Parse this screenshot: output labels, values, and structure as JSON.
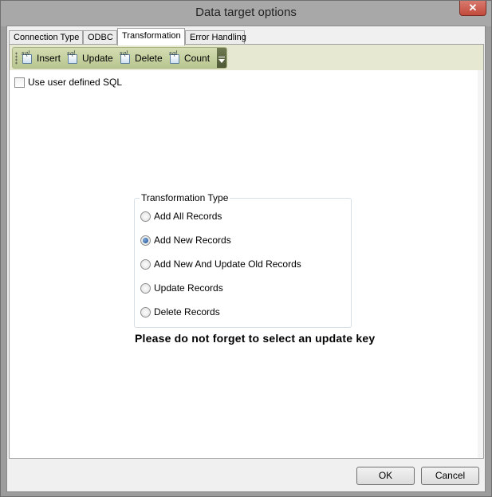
{
  "window": {
    "title": "Data target options",
    "close_glyph": "✕"
  },
  "tabs": [
    {
      "label": "Connection Type",
      "active": false
    },
    {
      "label": "ODBC",
      "active": false
    },
    {
      "label": "Transformation",
      "active": true
    },
    {
      "label": "Error Handling",
      "active": false
    }
  ],
  "toolbar": {
    "buttons": [
      {
        "label": "Insert",
        "icon": "sql-icon",
        "icon_text": "sql"
      },
      {
        "label": "Update",
        "icon": "sql-icon",
        "icon_text": "sql"
      },
      {
        "label": "Delete",
        "icon": "sql-icon",
        "icon_text": "sql"
      },
      {
        "label": "Count",
        "icon": "sql-icon",
        "icon_text": "sql"
      }
    ],
    "overflow_icon": "chevron-down-icon"
  },
  "options": {
    "use_user_defined_sql_label": "Use user defined SQL",
    "use_user_defined_sql_checked": false
  },
  "transformation_type": {
    "legend": "Transformation Type",
    "choices": [
      {
        "label": "Add All Records",
        "checked": false
      },
      {
        "label": "Add New Records",
        "checked": true
      },
      {
        "label": "Add New And Update Old Records",
        "checked": false
      },
      {
        "label": "Update Records",
        "checked": false
      },
      {
        "label": "Delete Records",
        "checked": false
      }
    ]
  },
  "warning_text": "Please do not forget to select an update key",
  "footer": {
    "ok_label": "OK",
    "cancel_label": "Cancel"
  },
  "colors": {
    "toolbar_band": "#e7e8d2",
    "toolbar": "#c6d1a1",
    "close_button": "#c7493a",
    "radio_selected": "#1c4f8f"
  }
}
